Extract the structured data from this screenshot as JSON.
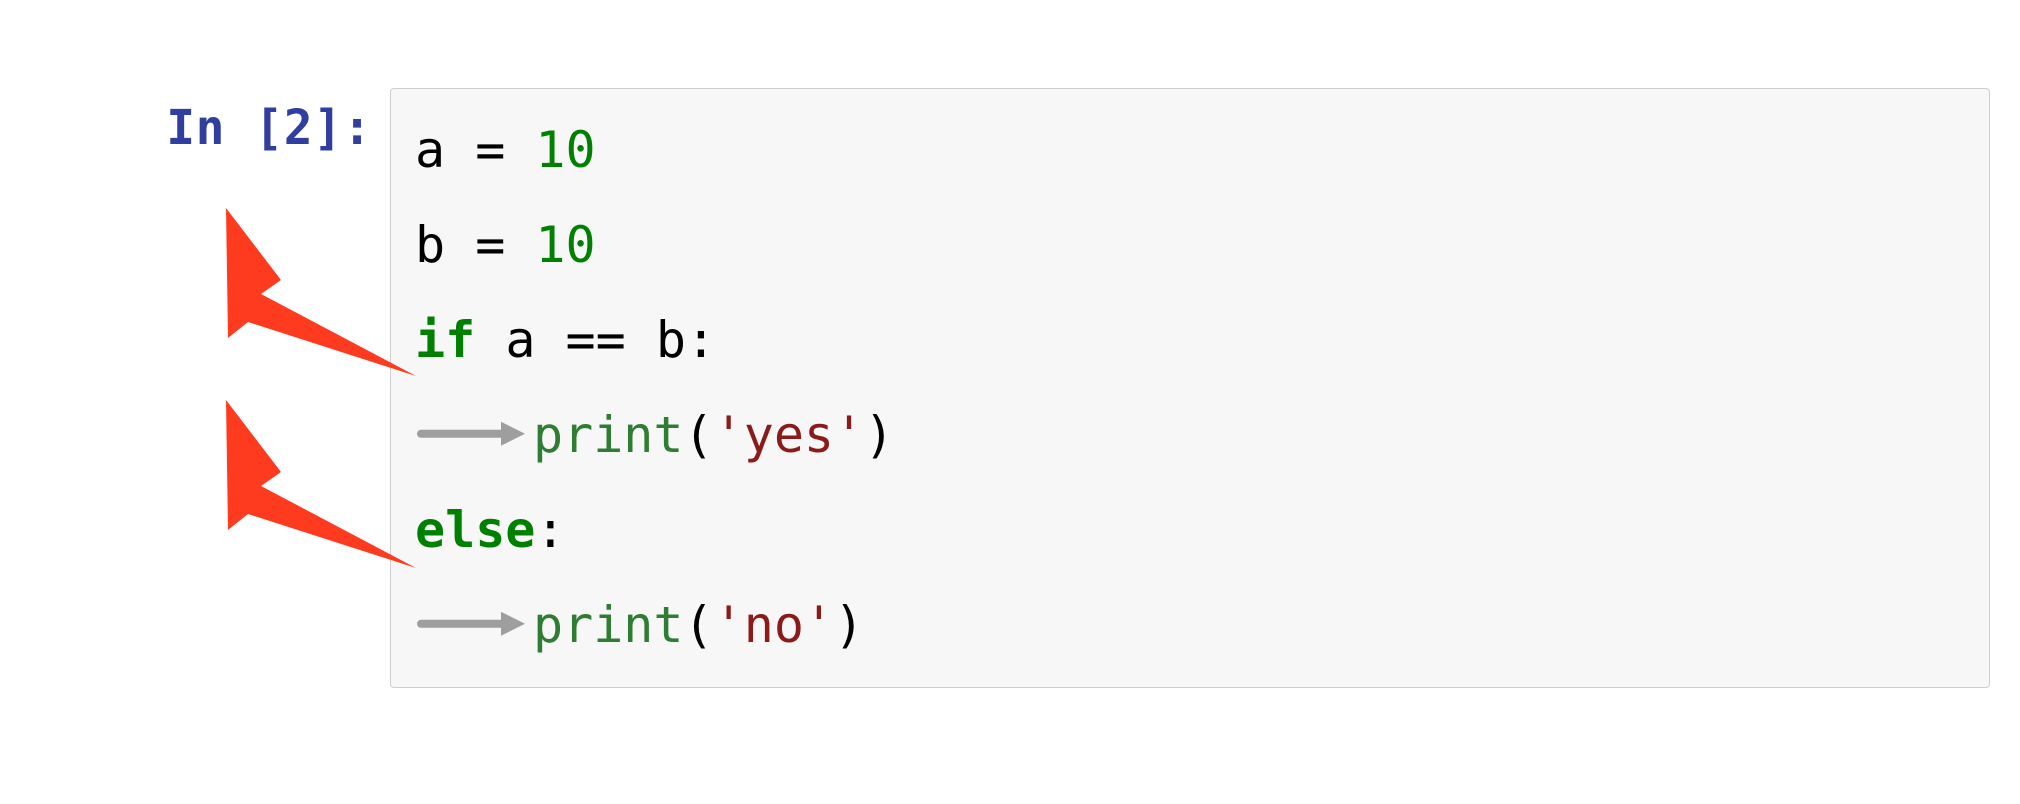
{
  "prompt": {
    "in_label": "In ",
    "in_index": "2",
    "in_suffix": "]:"
  },
  "code": {
    "l1": {
      "var": "a",
      "assign": " = ",
      "val": "10"
    },
    "l2": {
      "var": "b",
      "assign": " = ",
      "val": "10"
    },
    "l3": {
      "kw": "if",
      "cond": " a == b:"
    },
    "l4": {
      "call": "print",
      "open": "(",
      "str": "'yes'",
      "close": ")"
    },
    "l5": {
      "kw": "else",
      "colon": ":"
    },
    "l6": {
      "call": "print",
      "open": "(",
      "str": "'no'",
      "close": ")"
    }
  },
  "annotations": {
    "pointer1_target": "indented-print-yes",
    "pointer2_target": "indented-print-no"
  }
}
